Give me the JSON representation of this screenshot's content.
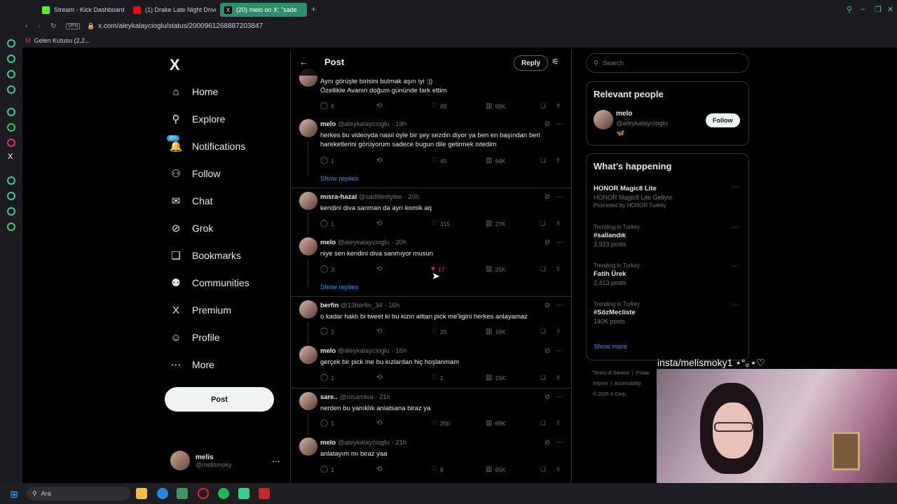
{
  "browser": {
    "tabs": [
      {
        "label": "Stream - Kick Dashboard",
        "color": "#53fc18"
      },
      {
        "label": "(1) Drake Late Night Drive",
        "color": "#ff0000"
      },
      {
        "label": "(20) melo on X: \"sade",
        "color": "#ffffff"
      }
    ],
    "vpn_label": "VPN",
    "url": "x.com/aleykalaycioglu/status/2000961268887203847",
    "bookmark": "Gelen Kutusu (2,2..."
  },
  "nav": {
    "logo": "X",
    "notifications_badge": "20+",
    "items": [
      {
        "label": "Home",
        "icon": "home-icon",
        "glyph": "⌂"
      },
      {
        "label": "Explore",
        "icon": "search-icon",
        "glyph": "⚲"
      },
      {
        "label": "Notifications",
        "icon": "bell-icon",
        "glyph": "🔔"
      },
      {
        "label": "Follow",
        "icon": "person-add-icon",
        "glyph": "⚇"
      },
      {
        "label": "Chat",
        "icon": "mail-icon",
        "glyph": "✉"
      },
      {
        "label": "Grok",
        "icon": "grok-icon",
        "glyph": "⊘"
      },
      {
        "label": "Bookmarks",
        "icon": "bookmark-icon",
        "glyph": "❏"
      },
      {
        "label": "Communities",
        "icon": "communities-icon",
        "glyph": "⚉"
      },
      {
        "label": "Premium",
        "icon": "x-premium-icon",
        "glyph": "X"
      },
      {
        "label": "Profile",
        "icon": "profile-icon",
        "glyph": "☺"
      },
      {
        "label": "More",
        "icon": "more-circle-icon",
        "glyph": "⋯"
      }
    ],
    "post_button": "Post",
    "account": {
      "name": "melis",
      "handle": "@melismoky"
    }
  },
  "main": {
    "title": "Post",
    "reply_button": "Reply",
    "tweets": [
      {
        "name": "",
        "handle": "",
        "time": "",
        "text": "Aynı görüşte birisini bulmak aşırı iyi :))\nÖzellikle Avanın doğum gününde fark ettim",
        "replies": "6",
        "reposts": "",
        "likes": "89",
        "views": "69K",
        "liked": false,
        "show_replies": ""
      },
      {
        "name": "melo",
        "handle": "@aleykalaycioglu",
        "time": "19h",
        "text": "herkes bu videoyda nasıl oyle bir şey sezdin diyor ya ben en başından beri hareketlerini görüyorum sadece bugun dile getirmek istedim",
        "replies": "1",
        "reposts": "",
        "likes": "45",
        "views": "64K",
        "liked": false,
        "show_replies": "Show replies"
      },
      {
        "name": "mısra-hazal",
        "handle": "@sadlifestylee",
        "time": "20h",
        "text": "kendini diva sanman da ayrı komik aq",
        "replies": "1",
        "reposts": "",
        "likes": "315",
        "views": "27K",
        "liked": false,
        "show_replies": ""
      },
      {
        "name": "melo",
        "handle": "@aleykalaycioglu",
        "time": "20h",
        "text": "niye sen kendini diva sanmıyor musun",
        "replies": "3",
        "reposts": "",
        "likes": "17",
        "views": "25K",
        "liked": true,
        "show_replies": "Show replies"
      },
      {
        "name": "berfin",
        "handle": "@13berfin_34",
        "time": "16h",
        "text": "o kadar haklı bi tweet ki bu kizin alttan pick me'ligini herkes anlayamaz",
        "replies": "2",
        "reposts": "",
        "likes": "25",
        "views": "16K",
        "liked": false,
        "show_replies": ""
      },
      {
        "name": "melo",
        "handle": "@aleykalaycioglu",
        "time": "16h",
        "text": "gerçek bir pick me bu kızlardan hiç hoşlanmam",
        "replies": "1",
        "reposts": "",
        "likes": "1",
        "views": "15K",
        "liked": false,
        "show_replies": ""
      },
      {
        "name": "sare..",
        "handle": "@rosamiva",
        "time": "21h",
        "text": "nerden bu yanıklık anlatsana biraz ya",
        "replies": "1",
        "reposts": "",
        "likes": "200",
        "views": "69K",
        "liked": false,
        "show_replies": ""
      },
      {
        "name": "melo",
        "handle": "@aleykalaycioglu",
        "time": "21h",
        "text": "anlatayım mı biraz yaa",
        "replies": "1",
        "reposts": "",
        "likes": "9",
        "views": "65K",
        "liked": false,
        "show_replies": ""
      }
    ]
  },
  "sidebar": {
    "search_placeholder": "Search",
    "relevant_title": "Relevant people",
    "person": {
      "name": "melo",
      "handle": "@aleykalaycioglu",
      "bio": "🦋",
      "follow": "Follow"
    },
    "happening_title": "What’s happening",
    "trends": [
      {
        "context": "",
        "name": "HONOR Magic8 Lite",
        "sub": "HONOR Magic8 Lite Geliyor",
        "extra": "Promoted by HONOR Turkey"
      },
      {
        "context": "Trending in Turkey",
        "name": "#sallandık",
        "sub": "3,923 posts",
        "extra": ""
      },
      {
        "context": "Trending in Turkey",
        "name": "Fatih Ürek",
        "sub": "2,413 posts",
        "extra": ""
      },
      {
        "context": "Trending in Turkey",
        "name": "#SözMecliste",
        "sub": "140K posts",
        "extra": ""
      }
    ],
    "show_more": "Show more",
    "footer": {
      "terms": "Terms of Service",
      "privacy": "Privac",
      "imprint": "Imprint",
      "accessibility": "Accessibility",
      "copyright": "© 2025 X Corp."
    }
  },
  "overlay": {
    "label": "insta/melismoky1 ⋆°｡⋆♡"
  },
  "taskbar": {
    "search": "Ara"
  }
}
